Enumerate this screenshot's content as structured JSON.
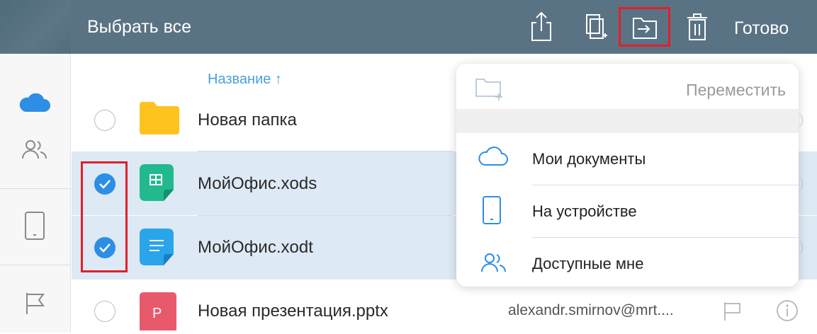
{
  "toolbar": {
    "select_all_label": "Выбрать все",
    "done_label": "Готово",
    "icons": [
      "share-icon",
      "copy-icon",
      "move-icon",
      "delete-icon"
    ],
    "background_color": "#5a7384"
  },
  "sidebar": {
    "items": [
      "cloud-icon",
      "shared-people-icon",
      "device-icon",
      "flag-icon"
    ],
    "active_color": "#2d8ee6"
  },
  "list": {
    "sort_header": "Название ↑",
    "files": [
      {
        "name": "Новая папка",
        "type": "folder",
        "selected": false
      },
      {
        "name": "МойОфис.xods",
        "type": "spreadsheet",
        "selected": true
      },
      {
        "name": "МойОфис.xodt",
        "type": "text-document",
        "selected": true
      },
      {
        "name": "Новая презентация.pptx",
        "type": "presentation",
        "selected": false,
        "owner": "alexandr.smirnov@mrt...."
      }
    ]
  },
  "popover": {
    "move_label": "Переместить",
    "locations": [
      {
        "label": "Мои документы",
        "icon": "cloud-icon"
      },
      {
        "label": "На устройстве",
        "icon": "tablet-icon"
      },
      {
        "label": "Доступные мне",
        "icon": "people-icon"
      }
    ]
  }
}
